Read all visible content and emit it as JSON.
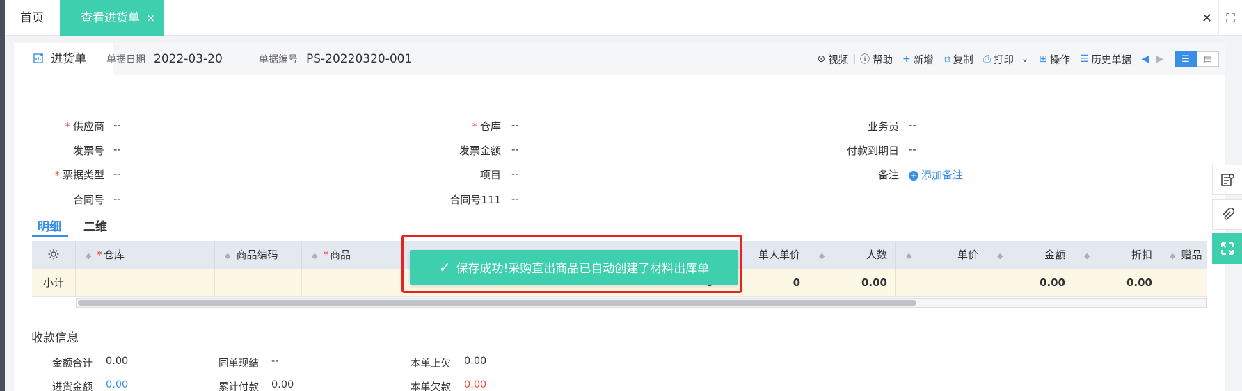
{
  "topbar": {
    "home_tab": "首页",
    "active_tab": "查看进货单",
    "close_glyph": "×"
  },
  "header": {
    "doc_tab": "进货单",
    "date_label": "单据日期",
    "date_value": "2022-03-20",
    "number_label": "单据编号",
    "number_value": "PS-20220320-001"
  },
  "toolbar": {
    "video": "视频",
    "divider": "|",
    "help": "帮助",
    "add": "新增",
    "copy": "复制",
    "print": "打印",
    "operate": "操作",
    "history": "历史单据"
  },
  "form": {
    "supplier_label": "供应商",
    "supplier_value": "--",
    "warehouse_label": "仓库",
    "warehouse_value": "--",
    "salesman_label": "业务员",
    "salesman_value": "--",
    "invoice_no_label": "发票号",
    "invoice_no_value": "--",
    "invoice_amount_label": "发票金额",
    "invoice_amount_value": "--",
    "due_date_label": "付款到期日",
    "due_date_value": "--",
    "bill_type_label": "票据类型",
    "bill_type_value": "--",
    "project_label": "项目",
    "project_value": "--",
    "remark_label": "备注",
    "remark_add": "添加备注",
    "contract_label": "合同号",
    "contract_value": "--",
    "contract111_label": "合同号111",
    "contract111_value": "--",
    "required_mark": "*"
  },
  "subtabs": [
    "明细",
    "二维"
  ],
  "grid": {
    "columns": [
      "仓库",
      "商品编码",
      "商品",
      "单人单价",
      "人数",
      "单价",
      "金额",
      "折扣",
      "赠品"
    ],
    "subtotal_label": "小计",
    "subtotal_values": [
      "0",
      "0",
      "0.00",
      "0.00",
      "0.00"
    ]
  },
  "toast": {
    "message": "保存成功!采购直出商品已自动创建了材料出库单",
    "check": "✓"
  },
  "payment": {
    "title": "收款信息",
    "total_label": "金额合计",
    "total_value": "0.00",
    "cash_label": "同单现结",
    "cash_value": "--",
    "prev_owe_label": "本单上欠",
    "prev_owe_value": "0.00",
    "purchase_amount_label": "进货金额",
    "purchase_amount_value": "0.00",
    "paid_label": "累计付款",
    "paid_value": "0.00",
    "owe_label": "本单欠款",
    "owe_value": "0.00"
  },
  "icons": {
    "close": "close-icon",
    "fullscreen": "fullscreen-icon",
    "settings": "gear-icon",
    "notes": "notes-icon",
    "attachment": "paperclip-icon",
    "expand": "expand-icon"
  },
  "colors": {
    "accent_green": "#3ecfae",
    "primary_blue": "#3a8ee6",
    "required_red": "#f0483e",
    "highlight_red": "#e8231a"
  }
}
